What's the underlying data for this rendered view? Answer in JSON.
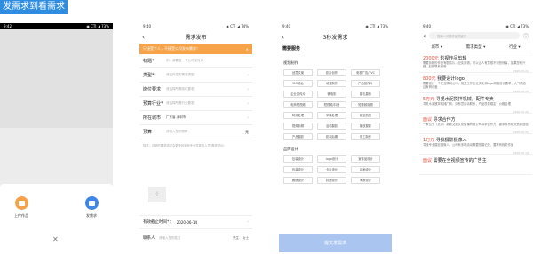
{
  "caption": "发需求到看需求",
  "s1": {
    "time": "9:42",
    "status": "◉ CTI ◢ 73%",
    "upload_label": "上传作品",
    "publish_label": "发需求",
    "close": "✕",
    "upload_color": "#f5a34b",
    "publish_color": "#3d86e8"
  },
  "s2": {
    "time": "9:40",
    "status": "◉ CTI ◢ 74%",
    "title": "需求发布",
    "banner": "只接受个人，不接受公司发布需求！",
    "banner_close": "✕",
    "rows": [
      {
        "label": "标题*",
        "value": "例：我要做一个公司宣传片"
      },
      {
        "label": "类型*",
        "value": "请选择发布需求类型"
      },
      {
        "label": "岗位要求",
        "value": "请选择所需岗位要求"
      },
      {
        "label": "预算行业*",
        "value": "请选择所需行业要求"
      },
      {
        "label": "所在城市",
        "value": "广东省-深圳市"
      },
      {
        "label": "预算",
        "value": "请输入您的预算",
        "unit": "元"
      }
    ],
    "desc_placeholder": "描述：详细的要求描述会更快找到有专业性能的人员(需求提示)",
    "deadline_label": "有效截止时间*：",
    "deadline_value": "2020-06-14",
    "contact_label": "联系人",
    "contact_placeholder": "请输入您的姓名",
    "gender": [
      "先生",
      "女士"
    ]
  },
  "s3": {
    "time": "9:40",
    "status": "◉ CTI ◢ 73%",
    "title": "3秒发需求",
    "section": "需要服务",
    "video_title": "视频制作",
    "video_tags": [
      "创意文案",
      "影片创作",
      "电视广告/TVC",
      "MG动画",
      "动漫制作",
      "产品宣传片",
      "企业宣传片",
      "微电影",
      "婚礼摄像",
      "电商短视频",
      "短视频/抖音",
      "短视频剪辑",
      "特效处理",
      "字幕处理",
      "航空航拍",
      "视频剪辑",
      "活动摄影",
      "播放摄影",
      "产品摄影",
      "影视后期",
      "双工制作"
    ],
    "brand_title": "品牌设计",
    "brand_tags": [
      "包装设计",
      "logo设计",
      "宣传品设计",
      "包装设计",
      "卡片设计",
      "动画设计",
      "画册设计",
      "封面设计",
      "海报设计"
    ],
    "button": "提交发需求"
  },
  "s4": {
    "time": "9:40",
    "status": "◉ CTI ◢ 73%",
    "search_placeholder": "搜索人才或作品关键字",
    "filters": [
      "城市",
      "需求类型",
      "行业"
    ],
    "cards": [
      {
        "price": "2000元",
        "title": "影视作品剪辑",
        "desc": "需要剪辑的作品有剧情片，纪实剪辑，可以让人有意想不到的惊喜，如果您有兴趣，赶快联系我哦",
        "meta": "2020.05.21"
      },
      {
        "price": "800元",
        "title": "我要设计logo",
        "desc": "需要设计一个在互联网公司，相关工作企业文化和logo风格设计要求，大气简洁且有辨识度",
        "meta": "2020.05.20"
      },
      {
        "price": "5万元",
        "title": "寻觅水泥搅拌机械，配件专卖",
        "desc": "寻觅水泥搅拌机械厂商，如有意向请联系，产品质量稳定，价格合理",
        "meta": "2020.05.20"
      },
      {
        "price": "面议",
        "title": "寻求合作方",
        "desc": "一家位于（北京）新款交通文化传播有限公司寻求合作方，要求具有相关资质经验",
        "meta": "2020.05.20"
      },
      {
        "price": "1万元",
        "title": "寻找摄影摄像人",
        "desc": "寻找专业摄影摄像人，公司有多场活动需要拍摄记录，要求有相关作品",
        "meta": "2020.05.19"
      },
      {
        "price": "面议",
        "title": "需要在全视频宣传的广告主",
        "desc": "",
        "meta": ""
      }
    ]
  }
}
